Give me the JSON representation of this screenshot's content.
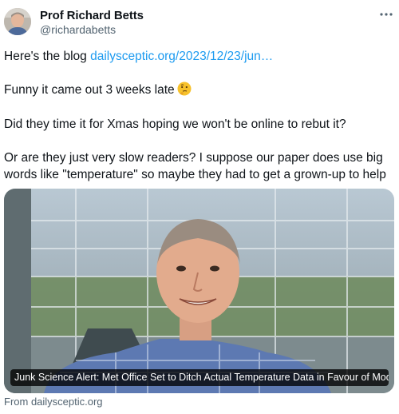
{
  "author": {
    "name": "Prof Richard Betts",
    "handle": "@richardabetts"
  },
  "post": {
    "line1_prefix": "Here's the blog ",
    "link_text": "dailysceptic.org/2023/12/23/jun…",
    "line2": "Funny it came out 3 weeks late",
    "line2_emoji": "thinking-face-emoji",
    "line3": "Did they time it for Xmas hoping we won't be online to rebut it?",
    "line4": "Or are they just very slow readers? I suppose our paper does use big",
    "line5": "words like \"temperature\" so maybe they had to get a grown-up to help"
  },
  "card": {
    "caption": "Junk Science Alert: Met Office Set to Ditch Actual Temperature Data in Favour of Model …",
    "source": "From dailysceptic.org"
  },
  "icons": {
    "more": "more-options-icon"
  },
  "colors": {
    "link": "#1d9bf0",
    "secondary_text": "#536471",
    "primary_text": "#0f1419"
  }
}
